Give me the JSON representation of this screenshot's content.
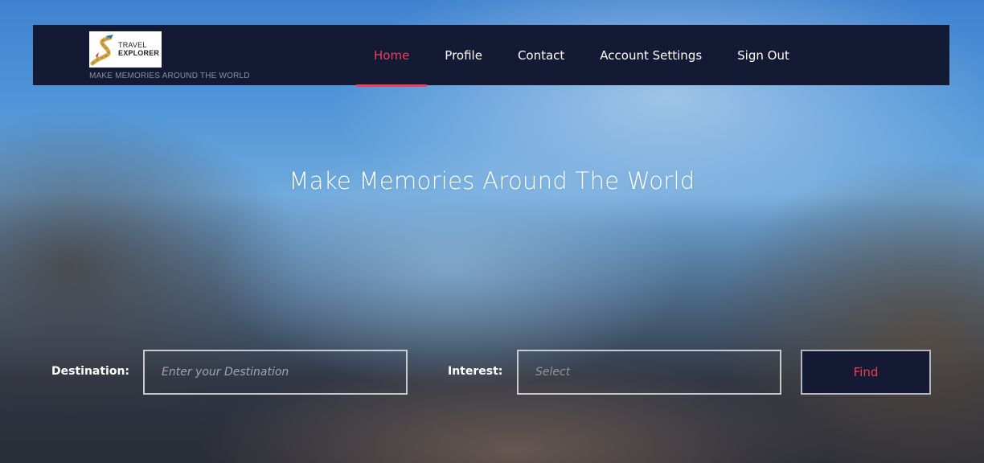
{
  "brand": {
    "logo_line1": "TRAVEL",
    "logo_line2": "EXPLORER",
    "tagline": "MAKE MEMORIES AROUND THE WORLD"
  },
  "nav": {
    "items": [
      {
        "label": "Home",
        "active": true
      },
      {
        "label": "Profile"
      },
      {
        "label": "Contact"
      },
      {
        "label": "Account Settings"
      },
      {
        "label": "Sign Out"
      }
    ],
    "accent_color": "#ef3e5a",
    "bar_color": "#141a33"
  },
  "hero": {
    "title": "Make Memories Around The World"
  },
  "search": {
    "destination_label": "Destination:",
    "destination_placeholder": "Enter your Destination",
    "interest_label": "Interest:",
    "interest_value": "Select",
    "find_label": "Find"
  }
}
